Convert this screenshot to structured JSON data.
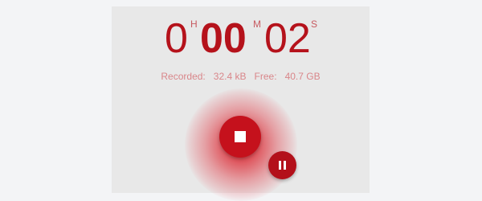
{
  "colors": {
    "accent": "#c5111c",
    "digit": "#b5121b",
    "status_text": "#d9868a",
    "background": "#e8e8e8",
    "page_background": "#f3f4f6"
  },
  "timer": {
    "hours": "0",
    "hours_unit": "H",
    "minutes": "00",
    "minutes_unit": "M",
    "seconds": "02",
    "seconds_unit": "S"
  },
  "status": {
    "recorded_label": "Recorded:",
    "recorded_value": "32.4 kB",
    "free_label": "Free:",
    "free_value": "40.7 GB"
  },
  "controls": {
    "stop_icon": "stop-icon",
    "pause_icon": "pause-icon"
  }
}
